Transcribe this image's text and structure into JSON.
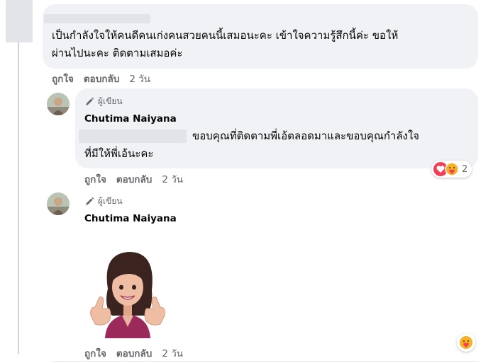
{
  "comments": [
    {
      "text": "เป็นกำลังใจให้คนดีคนเก่งคนสวยคนนี้เสมอนะคะ เข้าใจความรู้สึกนี้ค่ะ ขอให้ผ่านไปนะคะ ติดตามเสมอค่ะ",
      "line1": "เป็นกำลังใจให้คนดีคนเก่งคนสวยคนนี้เสมอนะคะ เข้าใจความรู้สึกนี้ค่ะ ขอให้",
      "line2": "ผ่านไปนะคะ ติดตามเสมอค่ะ",
      "like_label": "ถูกใจ",
      "reply_label": "ตอบกลับ",
      "time": "2 วัน"
    },
    {
      "badge": "ผู้เขียน",
      "author": "Chutima Naiyana",
      "line1": "ขอบคุณที่ติดตามพี่เอ้ตลอดมาและขอบคุณกำลังใจ",
      "line2": "ที่มีให้พี่เอ้นะคะ",
      "like_label": "ถูกใจ",
      "reply_label": "ตอบกลับ",
      "time": "2 วัน",
      "reaction_count": "2"
    },
    {
      "badge": "ผู้เขียน",
      "author": "Chutima Naiyana",
      "like_label": "ถูกใจ",
      "reply_label": "ตอบกลับ",
      "time": "2 วัน"
    }
  ],
  "icons": {
    "author_badge": "pencil-icon",
    "love": "heart-reaction-icon",
    "care": "care-reaction-icon"
  },
  "colors": {
    "bubble": "#f0f2f5",
    "action_text": "#65676b",
    "love": "#f33e58",
    "care": "#f7b125"
  }
}
